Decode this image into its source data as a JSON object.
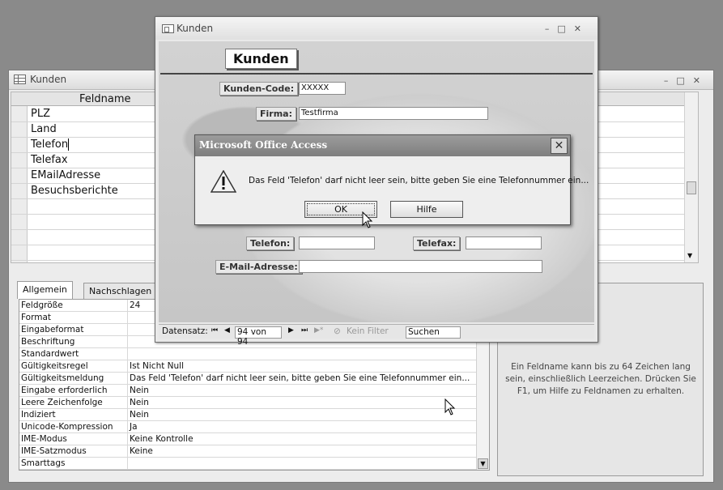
{
  "design_window": {
    "title": "Kunden",
    "column_header": "Feldname",
    "rows": [
      "PLZ",
      "Land",
      "Telefon",
      "Telefax",
      "EMailAdresse",
      "Besuchsberichte"
    ],
    "tabs": [
      "Allgemein",
      "Nachschlagen"
    ],
    "properties": [
      {
        "key": "Feldgröße",
        "value": "24"
      },
      {
        "key": "Format",
        "value": ""
      },
      {
        "key": "Eingabeformat",
        "value": ""
      },
      {
        "key": "Beschriftung",
        "value": ""
      },
      {
        "key": "Standardwert",
        "value": ""
      },
      {
        "key": "Gültigkeitsregel",
        "value": "Ist Nicht Null"
      },
      {
        "key": "Gültigkeitsmeldung",
        "value": "Das Feld 'Telefon' darf nicht leer sein, bitte geben Sie eine Telefonnummer ein..."
      },
      {
        "key": "Eingabe erforderlich",
        "value": "Nein"
      },
      {
        "key": "Leere Zeichenfolge",
        "value": "Nein"
      },
      {
        "key": "Indiziert",
        "value": "Nein"
      },
      {
        "key": "Unicode-Kompression",
        "value": "Ja"
      },
      {
        "key": "IME-Modus",
        "value": "Keine Kontrolle"
      },
      {
        "key": "IME-Satzmodus",
        "value": "Keine"
      },
      {
        "key": "Smarttags",
        "value": ""
      }
    ],
    "help_text": "Ein Feldname kann bis zu 64 Zeichen lang sein, einschließlich Leerzeichen. Drücken Sie F1, um Hilfe zu Feldnamen zu erhalten."
  },
  "form_window": {
    "title": "Kunden",
    "heading": "Kunden",
    "kunden_code_label": "Kunden-Code:",
    "kunden_code_value": "XXXXX",
    "firma_label": "Firma:",
    "firma_value": "Testfirma",
    "telefon_label": "Telefon:",
    "telefon_value": "",
    "telefax_label": "Telefax:",
    "telefax_value": "",
    "email_label": "E-Mail-Adresse:",
    "email_value": "",
    "nav": {
      "label": "Datensatz:",
      "position": "94 von 94",
      "filter": "Kein Filter",
      "search": "Suchen"
    }
  },
  "dialog": {
    "title": "Microsoft Office Access",
    "message": "Das Feld 'Telefon' darf nicht leer sein, bitte geben Sie eine Telefonnummer ein...",
    "ok_label": "OK",
    "help_label": "Hilfe",
    "icon": "warning-icon"
  },
  "window_controls": {
    "minimize": "–",
    "maximize": "□",
    "close": "✕"
  }
}
